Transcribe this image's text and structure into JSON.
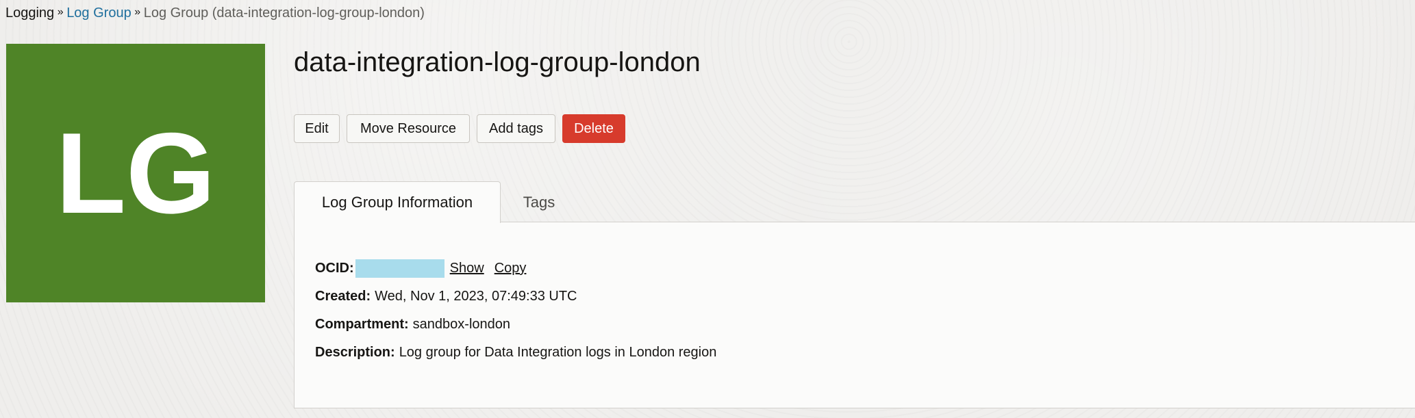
{
  "breadcrumb": {
    "root": "Logging",
    "link": "Log Group",
    "current": "Log Group (data-integration-log-group-london)",
    "separator": "»"
  },
  "avatar": {
    "initials": "LG",
    "background": "#4f8427"
  },
  "title": "data-integration-log-group-london",
  "actions": {
    "edit": "Edit",
    "move": "Move Resource",
    "add_tags": "Add tags",
    "delete": "Delete",
    "delete_color": "#d73b2c"
  },
  "tabs": {
    "active": "Log Group Information",
    "inactive": "Tags"
  },
  "info": {
    "ocid_label": "OCID:",
    "ocid_show": "Show",
    "ocid_copy": "Copy",
    "created_label": "Created:",
    "created_value": "Wed, Nov 1, 2023, 07:49:33 UTC",
    "compartment_label": "Compartment:",
    "compartment_value": "sandbox-london",
    "description_label": "Description:",
    "description_value": "Log group for Data Integration logs in London region"
  }
}
